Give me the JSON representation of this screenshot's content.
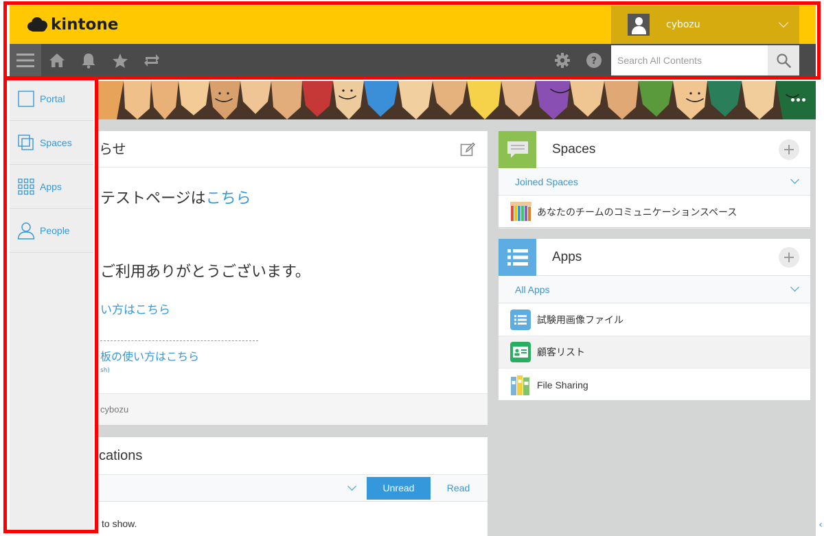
{
  "header": {
    "brand": "kintone",
    "user_name": "cybozu"
  },
  "nav": {
    "icons": [
      "menu-icon",
      "home-icon",
      "bell-icon",
      "star-icon",
      "repeat-icon",
      "gear-icon",
      "help-icon"
    ],
    "search_placeholder": "Search All Contents"
  },
  "left_nav": {
    "items": [
      {
        "label": "Portal",
        "icon": "portal-icon"
      },
      {
        "label": "Spaces",
        "icon": "spaces-icon"
      },
      {
        "label": "Apps",
        "icon": "apps-grid-icon"
      },
      {
        "label": "People",
        "icon": "person-icon"
      }
    ]
  },
  "notice": {
    "title": "らせ",
    "line1_text": "テストページは",
    "line1_link": "こちら",
    "line2_text": "ご利用ありがとうございます。",
    "line3_link": "い方はこちら",
    "line4_link": "板の使い方はこちら",
    "line4_small": "sh)",
    "footer_author": "cybozu"
  },
  "notifications": {
    "title": "cations",
    "unread_label": "Unread",
    "read_label": "Read",
    "empty_text": "to show."
  },
  "spaces": {
    "title": "Spaces",
    "filter": "Joined Spaces",
    "items": [
      {
        "name": "あなたのチームのコミュニケーションスペース"
      }
    ]
  },
  "apps": {
    "title": "Apps",
    "filter": "All Apps",
    "items": [
      {
        "name": "試験用画像ファイル",
        "icon": "list-app-icon"
      },
      {
        "name": "顧客リスト",
        "icon": "contact-card-icon"
      },
      {
        "name": "File Sharing",
        "icon": "binders-icon"
      }
    ]
  },
  "colors": {
    "header_yellow": "#ffc800",
    "user_area": "#d6ab10",
    "nav_dark": "#4a4a4a",
    "link_blue": "#3498db",
    "annotation_red": "#ff0000"
  }
}
